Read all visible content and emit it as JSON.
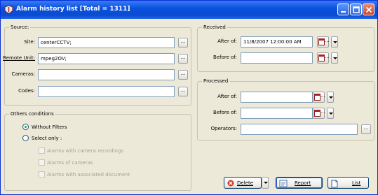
{
  "window": {
    "title": "Alarm history list [Total = 1311]"
  },
  "source": {
    "legend": "Source:",
    "site_label": "Site:",
    "site_value": "centerCCTV;",
    "remote_unit_label": "Remote Unit:",
    "remote_unit_value": "mpeg2OV;",
    "cameras_label": "Cameras:",
    "cameras_value": "",
    "codes_label": "Codes:",
    "codes_value": "",
    "browse_label": "..."
  },
  "received": {
    "legend": "Received",
    "after_label": "After of:",
    "after_value": "11/8/2007 12:00:00 AM",
    "before_label": "Before of:",
    "before_value": ""
  },
  "processed": {
    "legend": "Processed",
    "after_label": "After of:",
    "after_value": "",
    "before_label": "Before of:",
    "before_value": "",
    "operators_label": "Operators:",
    "operators_value": ""
  },
  "calendar_dots": "...",
  "others": {
    "legend": "Others conditions",
    "without_filters": "Without Filters",
    "select_only": "Select only :",
    "selected_option": "without_filters",
    "opt_camera_recordings": "Alarms with camera recordings",
    "opt_cameras": "Alarms of cameras",
    "opt_associated_document": "Alarms with associated document"
  },
  "buttons": {
    "delete": "Delete",
    "report": "Report",
    "list": "List"
  },
  "colors": {
    "titlebar": "#0b52e0",
    "window_bg": "#ece9d8",
    "field_border": "#7f9db9"
  }
}
